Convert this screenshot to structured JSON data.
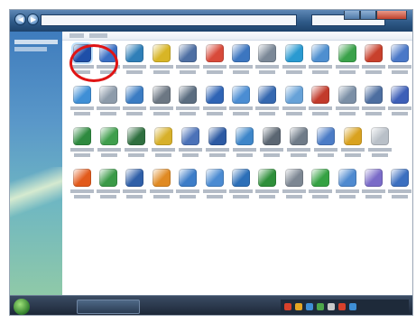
{
  "window": {
    "address_text": "",
    "search_placeholder": ""
  },
  "sidebar": {
    "links": [
      "",
      ""
    ]
  },
  "content": {
    "column_headers": [
      "",
      ""
    ]
  },
  "icons": {
    "rows": [
      [
        {
          "label": "",
          "color": "#1e4fa8",
          "selected": true
        },
        {
          "label": "",
          "color": "#3a6fc4"
        },
        {
          "label": "",
          "color": "#2f7fb8"
        },
        {
          "label": "",
          "color": "#d8b526"
        },
        {
          "label": "",
          "color": "#4e6fa3"
        },
        {
          "label": "",
          "color": "#d84a3a"
        },
        {
          "label": "",
          "color": "#3c76c0"
        },
        {
          "label": "",
          "color": "#7b8897"
        },
        {
          "label": "",
          "color": "#2a9ad1"
        },
        {
          "label": "",
          "color": "#4e8fd0"
        },
        {
          "label": "",
          "color": "#3aa24a"
        },
        {
          "label": "",
          "color": "#c8402c"
        },
        {
          "label": "",
          "color": "#4a78c8"
        }
      ],
      [
        {
          "label": "",
          "color": "#3f8fd6"
        },
        {
          "label": "",
          "color": "#8d9baa"
        },
        {
          "label": "",
          "color": "#3b7cc3"
        },
        {
          "label": "",
          "color": "#6c7783"
        },
        {
          "label": "",
          "color": "#5b6d80"
        },
        {
          "label": "",
          "color": "#2f64b5"
        },
        {
          "label": "",
          "color": "#4b8dd3"
        },
        {
          "label": "",
          "color": "#3568b0"
        },
        {
          "label": "",
          "color": "#67a2d8"
        },
        {
          "label": "",
          "color": "#c23a2b"
        },
        {
          "label": "",
          "color": "#7b8fa6"
        },
        {
          "label": "",
          "color": "#4d6ea0"
        },
        {
          "label": "",
          "color": "#3d5fb8"
        }
      ],
      [
        {
          "label": "",
          "color": "#2e8a3f"
        },
        {
          "label": "",
          "color": "#3f9e4c"
        },
        {
          "label": "",
          "color": "#2f6f3f"
        },
        {
          "label": "",
          "color": "#d7b02a"
        },
        {
          "label": "",
          "color": "#4b72b8"
        },
        {
          "label": "",
          "color": "#2d5aa3"
        },
        {
          "label": "",
          "color": "#3e86c9"
        },
        {
          "label": "",
          "color": "#5b6672"
        },
        {
          "label": "",
          "color": "#6f7b88"
        },
        {
          "label": "",
          "color": "#4c7cc6"
        },
        {
          "label": "",
          "color": "#d9a21f"
        },
        {
          "label": "",
          "color": "#b9c0c8"
        }
      ],
      [
        {
          "label": "",
          "color": "#e25a1c"
        },
        {
          "label": "",
          "color": "#3a9a47"
        },
        {
          "label": "",
          "color": "#2f5fa8"
        },
        {
          "label": "",
          "color": "#e08a23"
        },
        {
          "label": "",
          "color": "#3d7dc8"
        },
        {
          "label": "",
          "color": "#4b8bd2"
        },
        {
          "label": "",
          "color": "#2c6fb8"
        },
        {
          "label": "",
          "color": "#2e8f3a"
        },
        {
          "label": "",
          "color": "#7d8793"
        },
        {
          "label": "",
          "color": "#35a243"
        },
        {
          "label": "",
          "color": "#4f8ad0"
        },
        {
          "label": "",
          "color": "#7a6bc8"
        },
        {
          "label": "",
          "color": "#3b6fc0"
        }
      ]
    ]
  },
  "taskbar": {
    "window_button_label": "",
    "tray_colors": [
      "#d8412b",
      "#e6a623",
      "#3f8fd6",
      "#4da84a",
      "#c9c9c9",
      "#d8412b",
      "#3f8fd6"
    ]
  },
  "annotation": {
    "color": "#e01414"
  }
}
